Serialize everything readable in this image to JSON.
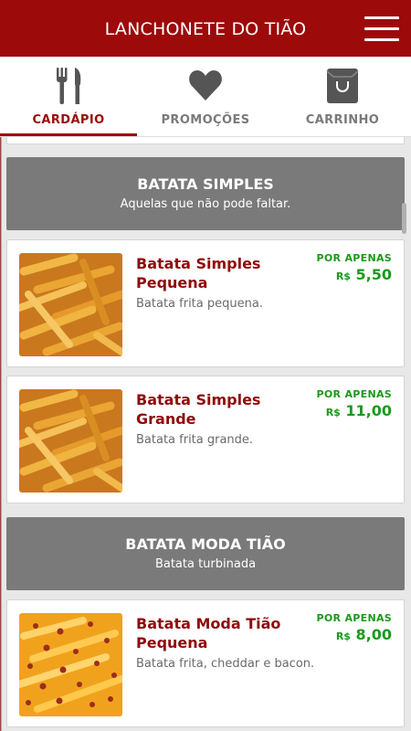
{
  "header": {
    "title": "LANCHONETE DO TIÃO",
    "menu_icon": "hamburger-icon"
  },
  "tabs": [
    {
      "label": "CARDÁPIO",
      "icon": "fork-knife-icon",
      "active": true
    },
    {
      "label": "PROMOÇÕES",
      "icon": "heart-icon",
      "active": false
    },
    {
      "label": "CARRINHO",
      "icon": "shopping-bag-icon",
      "active": false
    }
  ],
  "sections": [
    {
      "title": "BATATA SIMPLES",
      "subtitle": "Aquelas que não pode faltar."
    },
    {
      "title": "BATATA MODA TIÃO",
      "subtitle": "Batata turbinada"
    }
  ],
  "items": [
    {
      "name": "Batata Simples Pequena",
      "description": "Batata frita pequena.",
      "price_label": "POR APENAS",
      "currency": "R$",
      "price": "5,50",
      "image": "french-fries"
    },
    {
      "name": "Batata Simples Grande",
      "description": "Batata frita grande.",
      "price_label": "POR APENAS",
      "currency": "R$",
      "price": "11,00",
      "image": "french-fries"
    },
    {
      "name": "Batata Moda Tião Pequena",
      "description": "Batata frita, cheddar e bacon.",
      "price_label": "POR APENAS",
      "currency": "R$",
      "price": "8,00",
      "image": "cheddar-bacon-fries"
    }
  ],
  "colors": {
    "brand": "#9c0a0a",
    "price": "#1a9a1a",
    "section_bg": "#7a7a7a"
  }
}
